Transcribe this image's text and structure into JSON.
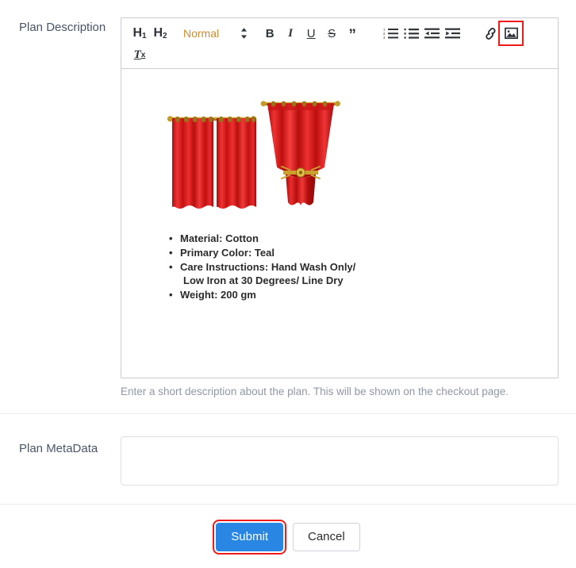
{
  "form": {
    "description_field": {
      "label": "Plan Description",
      "help_text": "Enter a short description about the plan. This will be shown on the checkout page."
    },
    "metadata_field": {
      "label": "Plan MetaData",
      "value": "",
      "placeholder": ""
    }
  },
  "editor": {
    "toolbar": {
      "heading1": "H",
      "heading1_sub": "1",
      "heading2": "H",
      "heading2_sub": "2",
      "format_picker_value": "Normal",
      "format_picker_accent": "#d08b2c",
      "bold": "B",
      "italic": "I",
      "underline": "U",
      "strikethrough": "S",
      "blockquote": "”",
      "ordered_list": "ordered-list-icon",
      "bullet_list": "bullet-list-icon",
      "outdent": "outdent-icon",
      "indent": "indent-icon",
      "link": "link-icon",
      "image": "image-icon",
      "clear_format": "T",
      "clear_format_sub": "x",
      "highlighted_button": "image-icon",
      "highlight_color": "#ef1b1b"
    },
    "content": {
      "image_alt": "red-curtains-product-image",
      "specs": [
        {
          "text": "Material: Cotton",
          "continuation": ""
        },
        {
          "text": "Primary Color: Teal",
          "continuation": ""
        },
        {
          "text": "Care Instructions: Hand Wash Only/",
          "continuation": "Low Iron at 30 Degrees/ Line Dry"
        },
        {
          "text": "Weight: 200 gm",
          "continuation": ""
        }
      ]
    }
  },
  "actions": {
    "submit_label": "Submit",
    "cancel_label": "Cancel",
    "submit_color": "#2a86e3",
    "submit_highlight_color": "#ef1b1b"
  }
}
